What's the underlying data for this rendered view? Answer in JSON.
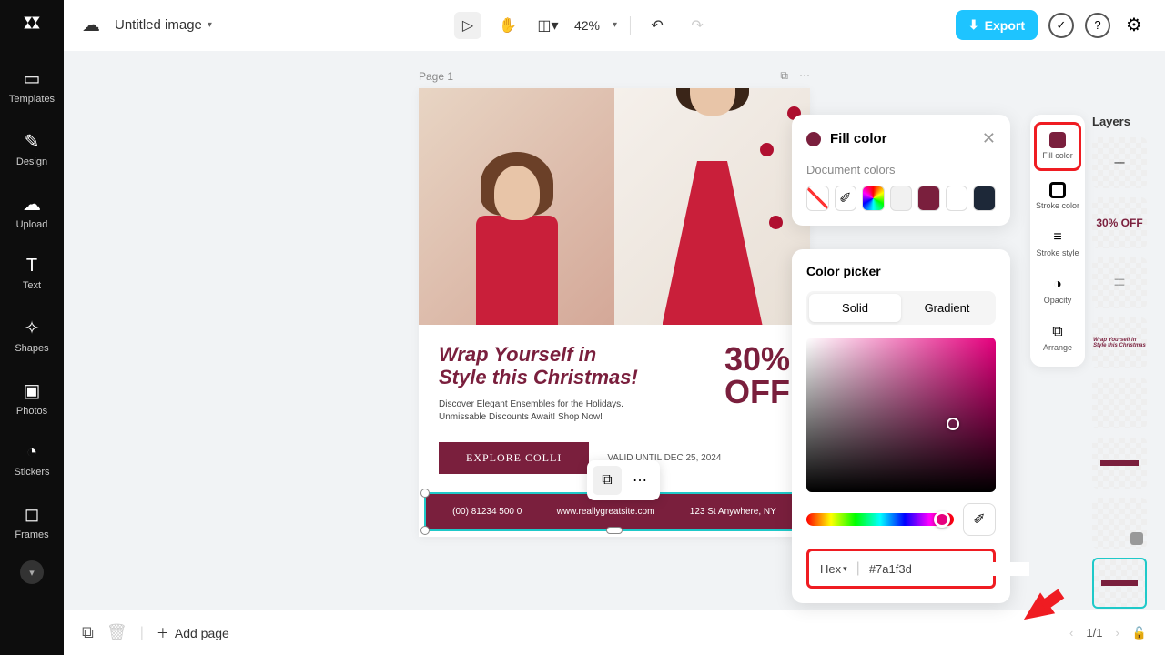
{
  "topbar": {
    "doc_title": "Untitled image",
    "zoom": "42%",
    "export_label": "Export"
  },
  "left_rail": [
    {
      "label": "Templates"
    },
    {
      "label": "Design"
    },
    {
      "label": "Upload"
    },
    {
      "label": "Text"
    },
    {
      "label": "Shapes"
    },
    {
      "label": "Photos"
    },
    {
      "label": "Stickers"
    },
    {
      "label": "Frames"
    }
  ],
  "page": {
    "label": "Page 1",
    "headline_l1": "Wrap Yourself in",
    "headline_l2": "Style this Christmas!",
    "sub_l1": "Discover Elegant Ensembles for the Holidays.",
    "sub_l2": "Unmissable Discounts Await! Shop Now!",
    "discount_l1": "30%",
    "discount_l2": "OFF",
    "cta": "EXPLORE COLLI",
    "valid": "VALID UNTIL DEC 25, 2024",
    "footer_phone": "(00) 81234 500 0",
    "footer_url": "www.reallygreatsite.com",
    "footer_addr": "123 St Anywhere, NY"
  },
  "fill_panel": {
    "title": "Fill color",
    "doc_colors_label": "Document colors",
    "swatches": [
      "#ffffff",
      "eyedropper",
      "rainbow",
      "#f1f1f1",
      "#7a1f3d",
      "#ffffff",
      "#1d2838"
    ]
  },
  "picker": {
    "title": "Color picker",
    "tabs": {
      "solid": "Solid",
      "gradient": "Gradient"
    },
    "hex_label": "Hex",
    "hex_value": "#7a1f3d"
  },
  "tool_rail": [
    {
      "label": "Fill color"
    },
    {
      "label": "Stroke color"
    },
    {
      "label": "Stroke style"
    },
    {
      "label": "Opacity"
    },
    {
      "label": "Arrange"
    }
  ],
  "layers": {
    "title": "Layers",
    "thumb_30off": "30% OFF"
  },
  "bottombar": {
    "add_page": "Add page",
    "page_count": "1/1"
  }
}
